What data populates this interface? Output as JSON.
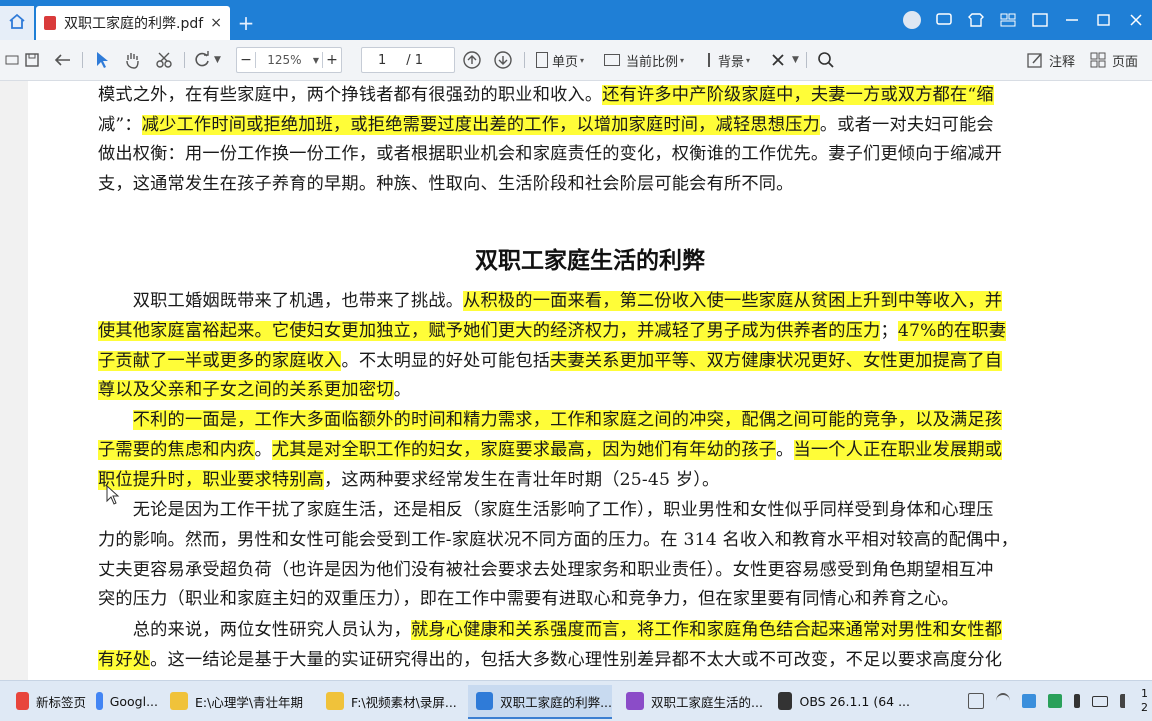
{
  "titlebar": {
    "tab_title": "双职工家庭的利弊.pdf",
    "close_glyph": "×",
    "new_tab_glyph": "+"
  },
  "toolbar": {
    "zoom": "125%",
    "page_current": "1",
    "page_total": "/ 1",
    "single_page": "单页",
    "current_ratio": "当前比例",
    "background": "背景",
    "annotate": "注释",
    "page_view": "页面"
  },
  "document": {
    "heading": "双职工家庭生活的利弊",
    "lines": [
      [
        {
          "t": "模式之外，在有些家庭中，两个挣钱者都有很强劲的职业和收入。",
          "h": false
        },
        {
          "t": "还有许多中产阶级家庭中，夫妻一方或双方都在“缩",
          "h": true
        }
      ],
      [
        {
          "t": "减”：",
          "h": false
        },
        {
          "t": "减少工作时间或拒绝加班，或拒绝需要过度出差的工作，以增加家庭时间，减轻思想压力",
          "h": true
        },
        {
          "t": "。或者一对夫妇可能会",
          "h": false
        }
      ],
      [
        {
          "t": "做出权衡：用一份工作换一份工作，或者根据职业机会和家庭责任的变化，权衡谁的工作优先。妻子们更倾向于缩减开",
          "h": false
        }
      ],
      [
        {
          "t": "支，这通常发生在孩子养育的早期。种族、性取向、生活阶段和社会阶层可能会有所不同。",
          "h": false
        }
      ],
      [
        {
          "t": "　　双职工婚姻既带来了机遇，也带来了挑战。",
          "h": false
        },
        {
          "t": "从积极的一面来看，第二份收入使一些家庭从贫困上升到中等收入，并",
          "h": true
        }
      ],
      [
        {
          "t": "使其他家庭富裕起来。它使妇女更加独立，赋予她们更大的经济权力，并减轻了男子成为供养者的压力",
          "h": true
        },
        {
          "t": "；",
          "h": false
        },
        {
          "t": "47%的在职妻",
          "h": true
        }
      ],
      [
        {
          "t": "子贡献了一半或更多的家庭收入",
          "h": true
        },
        {
          "t": "。不太明显的好处可能包括",
          "h": false
        },
        {
          "t": "夫妻关系更加平等、双方健康状况更好、女性更加提高了自",
          "h": true
        }
      ],
      [
        {
          "t": "尊以及父亲和子女之间的关系更加密切",
          "h": true
        },
        {
          "t": "。",
          "h": false
        }
      ],
      [
        {
          "t": "　　",
          "h": false
        },
        {
          "t": "不利的一面是，工作大多面临额外的时间和精力需求，工作和家庭之间的冲突，配偶之间可能的竞争，以及满足孩",
          "h": true
        }
      ],
      [
        {
          "t": "子需要的焦虑和内疚",
          "h": true
        },
        {
          "t": "。",
          "h": false
        },
        {
          "t": "尤其是对全职工作的妇女，家庭要求最高，因为她们有年幼的孩子",
          "h": true
        },
        {
          "t": "。",
          "h": false
        },
        {
          "t": "当一个人正在职业发展期或",
          "h": true
        }
      ],
      [
        {
          "t": "职位提升时，职业要求特别高",
          "h": true
        },
        {
          "t": "，这两种要求经常发生在青壮年时期（25-45 岁）。",
          "h": false
        }
      ],
      [
        {
          "t": "　　无论是因为工作干扰了家庭生活，还是相反（家庭生活影响了工作），职业男性和女性似乎同样受到身体和心理压",
          "h": false
        }
      ],
      [
        {
          "t": "力的影响。然而，男性和女性可能会受到工作-家庭状况不同方面的压力。在 314 名收入和教育水平相对较高的配偶中，",
          "h": false
        }
      ],
      [
        {
          "t": "丈夫更容易承受超负荷（也许是因为他们没有被社会要求去处理家务和职业责任）。女性更容易感受到角色期望相互冲",
          "h": false
        }
      ],
      [
        {
          "t": "突的压力（职业和家庭主妇的双重压力），即在工作中需要有进取心和竞争力，但在家里要有同情心和养育之心。",
          "h": false
        }
      ],
      [
        {
          "t": "　　总的来说，两位女性研究人员认为，",
          "h": false
        },
        {
          "t": "就身心健康和关系强度而言，将工作和家庭角色结合起来通常对男性和女性都",
          "h": true
        }
      ],
      [
        {
          "t": "有好处",
          "h": true
        },
        {
          "t": "。这一结论是基于大量的实证研究得出的，包括大多数心理性别差异都不太大或不可改变，不足以要求高度分化",
          "h": false
        }
      ]
    ]
  },
  "taskbar": {
    "items": [
      {
        "label": "新标签页",
        "color": "#e8453c"
      },
      {
        "label": "Googl...",
        "color": "#4285f4"
      },
      {
        "label": "E:\\心理学\\青壮年期",
        "color": "#f0c23a"
      },
      {
        "label": "F:\\视频素材\\录屏...",
        "color": "#f0c23a"
      },
      {
        "label": "双职工家庭的利弊...",
        "color": "#2f7bd8"
      },
      {
        "label": "双职工家庭生活的...",
        "color": "#8b4cc8"
      },
      {
        "label": "OBS 26.1.1 (64 ...",
        "color": "#333333"
      }
    ],
    "clock_top": "1",
    "clock_bottom": "2"
  }
}
